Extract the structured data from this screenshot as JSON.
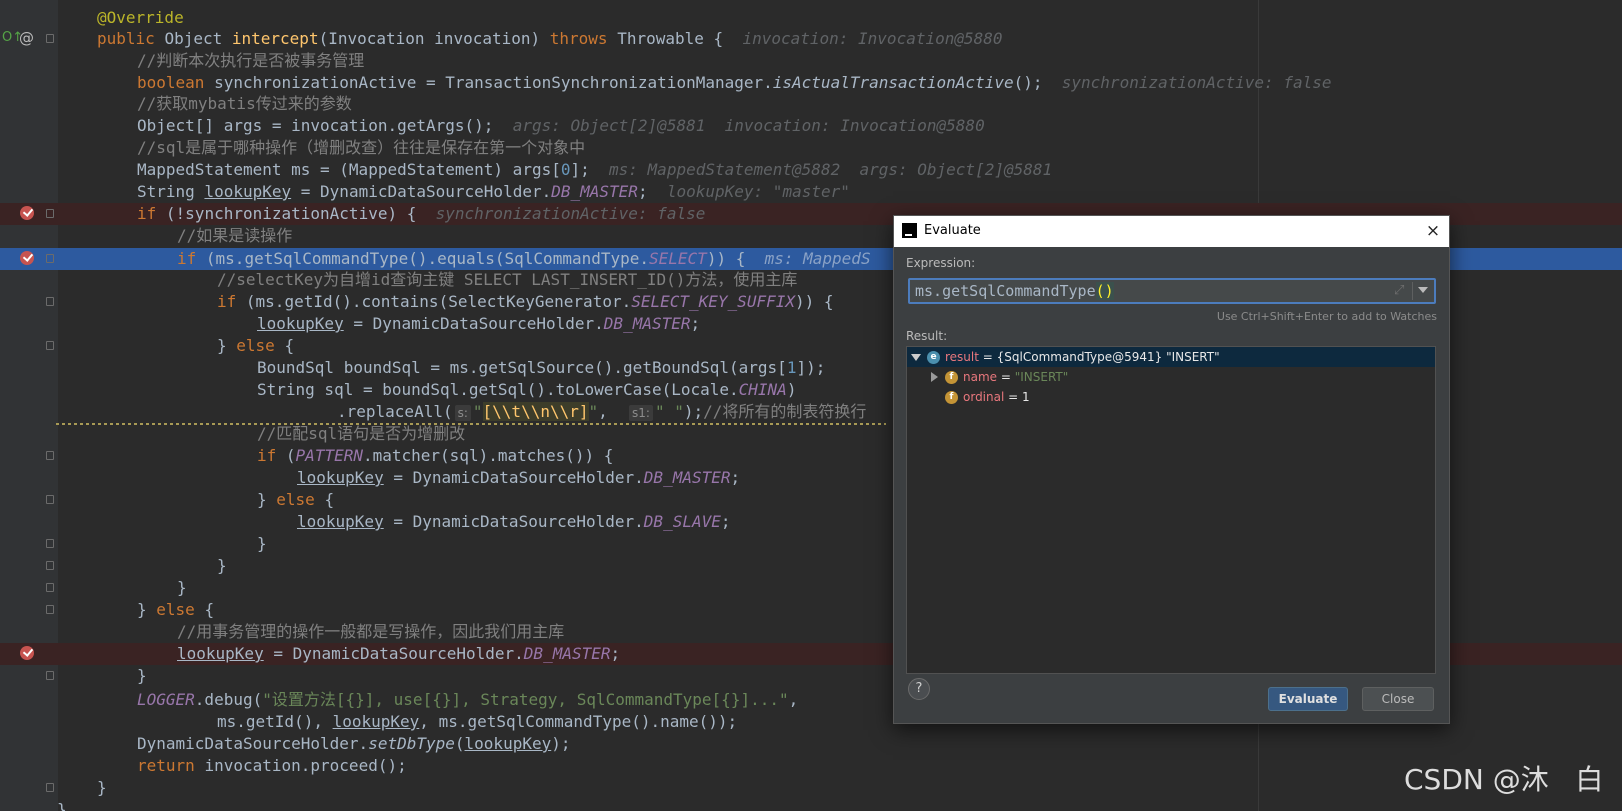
{
  "editor": {
    "lines": [
      {
        "text": "@Override",
        "type": "normal"
      },
      {
        "text": "public Object intercept(Invocation invocation) throws Throwable {  invocation: Invocation@5880",
        "type": "normal"
      },
      {
        "text": "//判断本次执行是否被事务管理",
        "type": "normal"
      },
      {
        "text": "boolean synchronizationActive = TransactionSynchronizationManager.isActualTransactionActive();  synchronizationActive: false",
        "type": "normal"
      },
      {
        "text": "//获取mybatis传过来的参数",
        "type": "normal"
      },
      {
        "text": "Object[] args = invocation.getArgs();  args: Object[2]@5881  invocation: Invocation@5880",
        "type": "normal"
      },
      {
        "text": "//sql是属于哪种操作（增删改查）往往是保存在第一个对象中",
        "type": "normal"
      },
      {
        "text": "MappedStatement ms = (MappedStatement) args[0];  ms: MappedStatement@5882  args: Object[2]@5881",
        "type": "normal"
      },
      {
        "text": "String lookupKey = DynamicDataSourceHolder.DB_MASTER;  lookupKey: \"master\"",
        "type": "normal"
      },
      {
        "text": "if (!synchronizationActive) {  synchronizationActive: false",
        "type": "breakpoint"
      },
      {
        "text": "//如果是读操作",
        "type": "normal"
      },
      {
        "text": "if (ms.getSqlCommandType().equals(SqlCommandType.SELECT)) {  ms: MappedS",
        "type": "execution-point"
      },
      {
        "text": "//selectKey为自增id查询主键 SELECT LAST_INSERT_ID()方法，使用主库",
        "type": "normal"
      },
      {
        "text": "if (ms.getId().contains(SelectKeyGenerator.SELECT_KEY_SUFFIX)) {",
        "type": "normal"
      },
      {
        "text": "lookupKey = DynamicDataSourceHolder.DB_MASTER;",
        "type": "normal"
      },
      {
        "text": "} else {",
        "type": "normal"
      },
      {
        "text": "BoundSql boundSql = ms.getSqlSource().getBoundSql(args[1]);",
        "type": "normal"
      },
      {
        "text": "String sql = boundSql.getSql().toLowerCase(Locale.CHINA)",
        "type": "normal"
      },
      {
        "text": ".replaceAll( s: \"[\\\\t\\\\n\\\\r]\",  s1: \" \");//将所有的制表符换行",
        "type": "normal"
      },
      {
        "text": "//匹配sql语句是否为增删改",
        "type": "normal"
      },
      {
        "text": "if (PATTERN.matcher(sql).matches()) {",
        "type": "normal"
      },
      {
        "text": "lookupKey = DynamicDataSourceHolder.DB_MASTER;",
        "type": "normal"
      },
      {
        "text": "} else {",
        "type": "normal"
      },
      {
        "text": "lookupKey = DynamicDataSourceHolder.DB_SLAVE;",
        "type": "normal"
      },
      {
        "text": "}",
        "type": "normal"
      },
      {
        "text": "}",
        "type": "normal"
      },
      {
        "text": "}",
        "type": "normal"
      },
      {
        "text": "} else {",
        "type": "normal"
      },
      {
        "text": "//用事务管理的操作一般都是写操作，因此我们用主库",
        "type": "normal"
      },
      {
        "text": "lookupKey = DynamicDataSourceHolder.DB_MASTER;",
        "type": "breakpoint"
      },
      {
        "text": "}",
        "type": "normal"
      },
      {
        "text": "LOGGER.debug(\"设置方法[{}], use[{}], Strategy, SqlCommandType[{}]...\",",
        "type": "normal"
      },
      {
        "text": "ms.getId(), lookupKey, ms.getSqlCommandType().name());",
        "type": "normal"
      },
      {
        "text": "DynamicDataSourceHolder.setDbType(lookupKey);",
        "type": "normal"
      },
      {
        "text": "return invocation.proceed();",
        "type": "normal"
      },
      {
        "text": "}",
        "type": "normal"
      },
      {
        "text": "}",
        "type": "normal"
      }
    ]
  },
  "dialog": {
    "title": "Evaluate",
    "expression_label": "Expression:",
    "expression_value": "ms.getSqlCommandType()",
    "watch_hint": "Use Ctrl+Shift+Enter to add to Watches",
    "result_label": "Result:",
    "tree": [
      {
        "name": "result",
        "eq": " = ",
        "value": "{SqlCommandType@5941} \"INSERT\"",
        "icon": "enum-icon",
        "badge": "e"
      },
      {
        "name": "name",
        "eq": " = ",
        "value": "\"INSERT\"",
        "icon": "field-icon",
        "badge": "f"
      },
      {
        "name": "ordinal",
        "eq": " = ",
        "value": "1",
        "icon": "field-icon",
        "badge": "f"
      }
    ],
    "help_label": "?",
    "evaluate_button": "Evaluate",
    "close_button": "Close",
    "close_icon": "×"
  },
  "watermark": "CSDN @沐   白",
  "colors": {
    "keyword": "#cc7832",
    "annotation": "#bbb529",
    "method": "#ffc66d",
    "comment": "#808080",
    "string": "#6a8759",
    "number": "#6897bb",
    "static": "#9876aa",
    "selection": "#2d5a9f",
    "breakpoint": "#c75450"
  }
}
